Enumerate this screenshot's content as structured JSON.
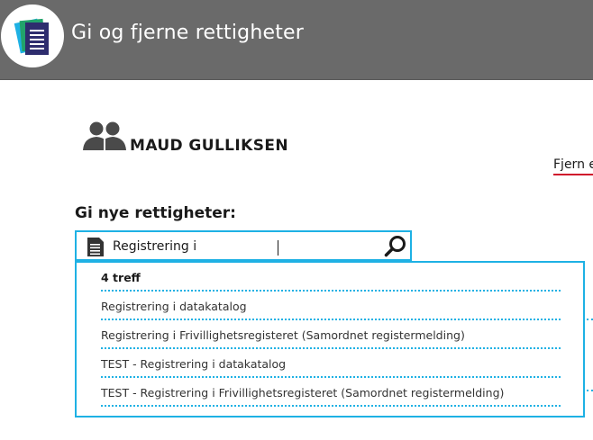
{
  "header": {
    "title": "Gi og fjerne rettigheter",
    "logo_icon": "documents-stack-icon"
  },
  "user": {
    "name": "MAUD GULLIKSEN",
    "icon": "users-icon"
  },
  "remove_link": "Fjern e",
  "search": {
    "label": "Gi nye rettigheter:",
    "value": "Registrering i",
    "input_icon": "document-icon",
    "button_icon": "search-icon"
  },
  "results": {
    "count_label": "4 treff",
    "items": [
      "Registrering i datakatalog",
      "Registrering i Frivillighetsregisteret (Samordnet registermelding)",
      "TEST - Registrering i datakatalog",
      "TEST - Registrering i Frivillighetsregisteret (Samordnet registermelding)"
    ]
  },
  "colors": {
    "header_bg": "#6a6a6a",
    "accent": "#1eb1e4",
    "link_underline": "#d0112b"
  }
}
